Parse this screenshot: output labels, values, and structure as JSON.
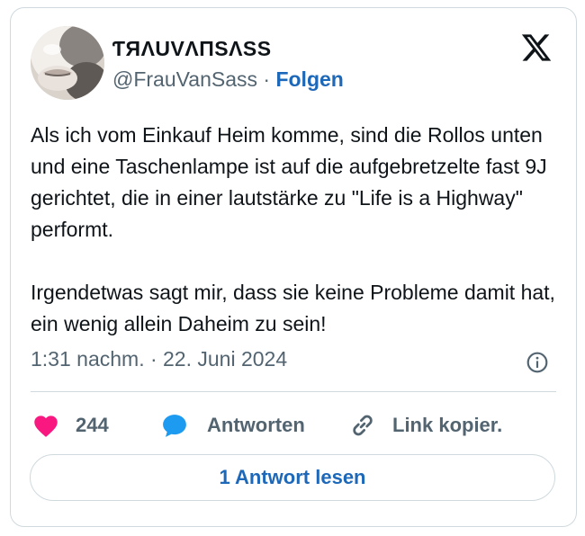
{
  "author": {
    "display_name": "ƬЯΛUVΛПSΛSS",
    "handle": "@FrauVanSass",
    "separator": "·",
    "follow_label": "Folgen"
  },
  "tweet": {
    "text": "Als ich vom Einkauf Heim komme, sind die Rollos unten und eine Taschenlampe ist auf die aufgebretzelte fast 9J gerichtet, die in einer lautstärke zu \"Life is a Highway\" performt.\n\nIrgendetwas sagt mir, dass sie keine Probleme damit hat, ein wenig allein Daheim zu sein!",
    "timestamp": "1:31 nachm. · 22. Juni 2024"
  },
  "actions": {
    "like_count": "244",
    "reply_label": "Antworten",
    "copy_label": "Link kopier."
  },
  "read_replies_label": "1 Antwort lesen",
  "icons": {
    "logo": "x-logo-icon",
    "info": "info-icon",
    "like": "heart-icon",
    "reply": "speech-bubble-icon",
    "copy": "link-icon"
  },
  "colors": {
    "text": "#0f1419",
    "muted": "#536471",
    "link": "#1d68b9",
    "heart": "#f91880",
    "reply_bubble": "#1d9bf0",
    "border": "#cfd9de"
  }
}
